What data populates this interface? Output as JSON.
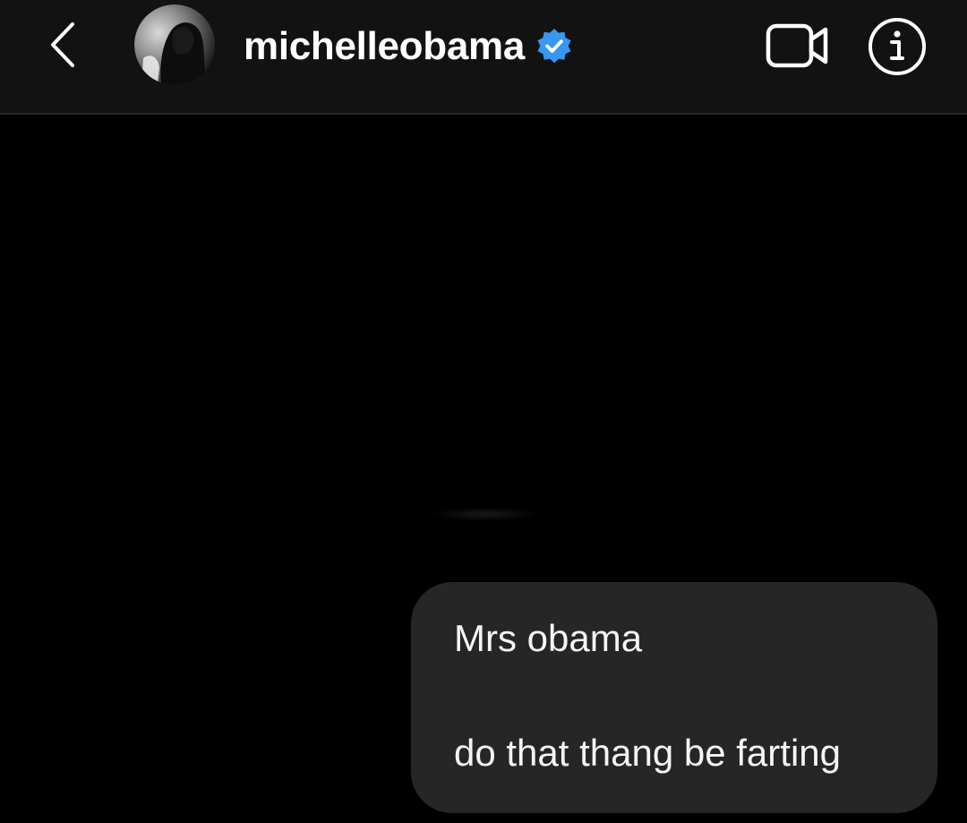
{
  "header": {
    "username": "michelleobama",
    "verified": true,
    "icons": {
      "back": "chevron-left-icon",
      "video_call": "video-camera-icon",
      "info": "info-icon",
      "verified": "verified-badge-icon"
    }
  },
  "colors": {
    "background": "#000000",
    "header_bg": "#121212",
    "bubble_bg": "#262626",
    "verified_blue": "#3897f0",
    "text": "#ffffff"
  },
  "messages": [
    {
      "sender": "me",
      "lines": [
        "Mrs obama",
        "do that thang be farting"
      ]
    }
  ]
}
